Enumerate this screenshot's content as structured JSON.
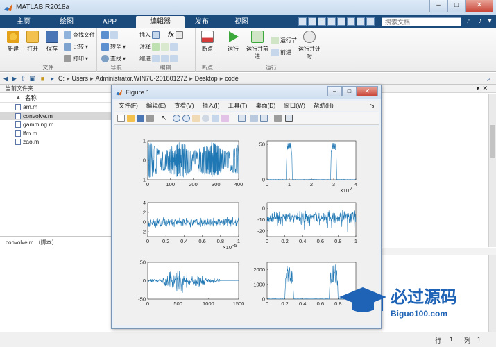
{
  "app": {
    "title": "MATLAB R2018a"
  },
  "window_controls": {
    "minimize": "–",
    "maximize": "□",
    "close": "✕"
  },
  "tabs": [
    {
      "label": "主页"
    },
    {
      "label": "绘图"
    },
    {
      "label": "APP"
    },
    {
      "label": "编辑器"
    },
    {
      "label": "发布"
    },
    {
      "label": "视图"
    }
  ],
  "search": {
    "placeholder": "搜索文档"
  },
  "ribbon": {
    "file_group": {
      "label": "文件",
      "new": "新建",
      "open": "打开",
      "save": "保存",
      "find_files": "查找文件",
      "compare": "比较",
      "print": "打印"
    },
    "nav_group": {
      "label": "导航",
      "goto": "转至",
      "find": "查找"
    },
    "edit_group": {
      "label": "编辑",
      "insert": "插入",
      "comment": "注释",
      "indent": "缩进",
      "fx": "fx"
    },
    "breakpoint_group": {
      "label": "断点",
      "breakpoints": "断点"
    },
    "run_group": {
      "label": "运行",
      "run": "运行",
      "run_advance": "运行并前进",
      "run_section": "运行节",
      "advance": "前进",
      "run_time": "运行并计时"
    }
  },
  "path": {
    "segments": [
      "C:",
      "Users",
      "Administrator.WIN7U-20180127Z",
      "Desktop",
      "code"
    ]
  },
  "file_browser": {
    "title": "当前文件夹",
    "column": "名称",
    "sort_arrow": "▲",
    "files": [
      {
        "name": "am.m",
        "selected": false
      },
      {
        "name": "convolve.m",
        "selected": true
      },
      {
        "name": "gamming.m",
        "selected": false
      },
      {
        "name": "lfm.m",
        "selected": false
      },
      {
        "name": "zao.m",
        "selected": false
      }
    ],
    "detail_label": "convolve.m （脚本）"
  },
  "figure": {
    "title": "Figure 1",
    "menus": [
      "文件(F)",
      "编辑(E)",
      "查看(V)",
      "插入(I)",
      "工具(T)",
      "桌面(D)",
      "窗口(W)",
      "帮助(H)"
    ],
    "menu_arrow": "↘",
    "subplots": [
      {
        "xticks": [
          "0",
          "100",
          "200",
          "300",
          "400"
        ],
        "yticks": [
          "1",
          "0",
          "-1"
        ],
        "xlim": [
          0,
          400
        ],
        "ylim": [
          -1,
          1
        ],
        "signal": "bounded-chirp"
      },
      {
        "xticks": [
          "0",
          "1",
          "2",
          "3",
          "4"
        ],
        "yticks": [
          "50",
          "0"
        ],
        "xlim": [
          0,
          4
        ],
        "ylim": [
          0,
          55
        ],
        "exponent": "×10",
        "exponent_sup": "7",
        "signal": "two-peaks",
        "peaks": [
          1.0,
          3.0
        ]
      },
      {
        "xticks": [
          "0",
          "0.2",
          "0.4",
          "0.6",
          "0.8",
          "1"
        ],
        "yticks": [
          "4",
          "2",
          "0",
          "-2"
        ],
        "xlim": [
          0,
          1
        ],
        "ylim": [
          -3,
          4
        ],
        "exponent": "×10",
        "exponent_sup": "-5",
        "signal": "noise"
      },
      {
        "xticks": [
          "0",
          "0.2",
          "0.4",
          "0.6",
          "0.8",
          "1"
        ],
        "yticks": [
          "0",
          "-10",
          "-20"
        ],
        "xlim": [
          0,
          1
        ],
        "ylim": [
          -25,
          5
        ],
        "signal": "noise-db"
      },
      {
        "xticks": [
          "0",
          "500",
          "1000",
          "1500"
        ],
        "yticks": [
          "50",
          "0",
          "-50"
        ],
        "xlim": [
          0,
          1500
        ],
        "ylim": [
          -50,
          50
        ],
        "signal": "burst"
      },
      {
        "xticks": [
          "0",
          "0.2",
          "0.4",
          "0.6",
          "0.8",
          "1"
        ],
        "yticks": [
          "2000",
          "1000",
          "0"
        ],
        "xlim": [
          0,
          1
        ],
        "ylim": [
          0,
          2500
        ],
        "signal": "two-peaks-wide",
        "peaks": [
          0.25,
          0.75
        ]
      }
    ]
  },
  "watermark": {
    "brand": "必过源码",
    "url": "Biguo100.com"
  },
  "status": {
    "row_label": "行",
    "row_value": "1",
    "col_label": "列",
    "col_value": "1"
  },
  "colors": {
    "plot_line": "#1f77b4",
    "tab_bar": "#1a4b7c",
    "watermark": "#1e63b6"
  }
}
